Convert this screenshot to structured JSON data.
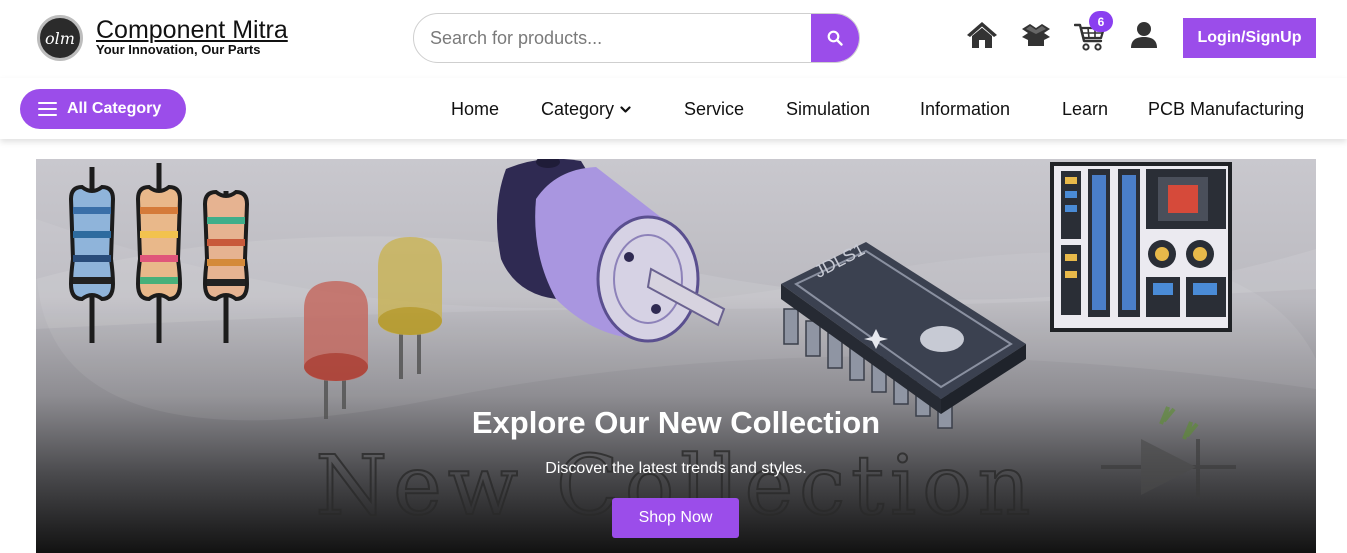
{
  "brand": {
    "mark_text": "olm",
    "name": "Component Mitra",
    "tagline": "Your Innovation, Our Parts"
  },
  "search": {
    "placeholder": "Search for products...",
    "value": ""
  },
  "header_icons": [
    "home-icon",
    "box-icon",
    "cart-icon",
    "user-icon"
  ],
  "cart": {
    "count": "6"
  },
  "auth": {
    "login_label": "Login/SignUp"
  },
  "nav": {
    "all_category_label": "All Category",
    "items": [
      "Home",
      "Category",
      "Service",
      "Simulation",
      "Information",
      "Learn",
      "PCB Manufacturing"
    ]
  },
  "hero": {
    "title": "Explore Our New Collection",
    "subtitle": "Discover the latest trends and styles.",
    "cta_label": "Shop Now",
    "background_text": "New Collection",
    "chip_marking": "JDLS1"
  },
  "colors": {
    "accent": "#9b4dea",
    "badge": "#8a3ff0",
    "text": "#111111"
  }
}
